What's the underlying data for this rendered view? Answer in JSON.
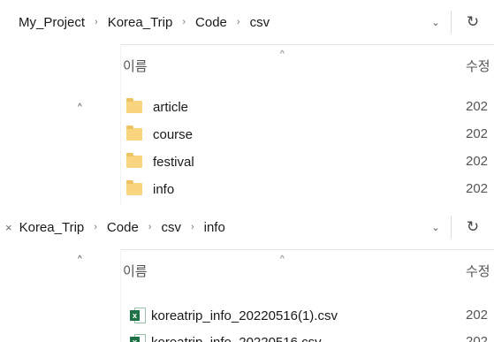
{
  "pane1": {
    "breadcrumb": [
      "My_Project",
      "Korea_Trip",
      "Code",
      "csv"
    ],
    "separator": "›",
    "dropdown_glyph": "⌄",
    "refresh_glyph": "↻",
    "up_glyph": "^",
    "column_name": "이름",
    "column_date": "수정",
    "sort_glyph": "^",
    "folders": [
      {
        "name": "article",
        "date": "202"
      },
      {
        "name": "course",
        "date": "202"
      },
      {
        "name": "festival",
        "date": "202"
      },
      {
        "name": "info",
        "date": "202"
      }
    ]
  },
  "pane2": {
    "lead_glyph": "×",
    "breadcrumb": [
      "Korea_Trip",
      "Code",
      "csv",
      "info"
    ],
    "separator": "›",
    "dropdown_glyph": "⌄",
    "refresh_glyph": "↻",
    "up_glyph": "^",
    "column_name": "이름",
    "column_date": "수정",
    "sort_glyph": "^",
    "files": [
      {
        "name": "koreatrip_info_20220516(1).csv",
        "date": "202",
        "icon": "excel-csv-icon"
      },
      {
        "name": "koreatrip_info_20220516.csv",
        "date": "202",
        "icon": "excel-csv-icon"
      }
    ]
  }
}
